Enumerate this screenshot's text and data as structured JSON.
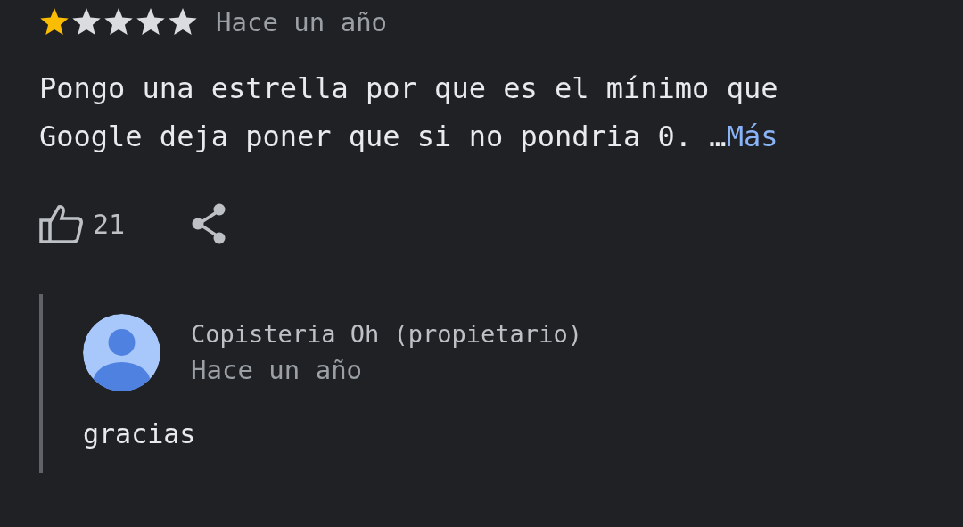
{
  "review": {
    "stars": 1,
    "time": "Hace un año",
    "text": "Pongo una estrella por que es el mínimo que Google deja poner que si no pondria 0. …",
    "more_link": "Más",
    "likes": "21"
  },
  "reply": {
    "author": "Copisteria Oh (propietario)",
    "time": "Hace un año",
    "text": "gracias"
  }
}
